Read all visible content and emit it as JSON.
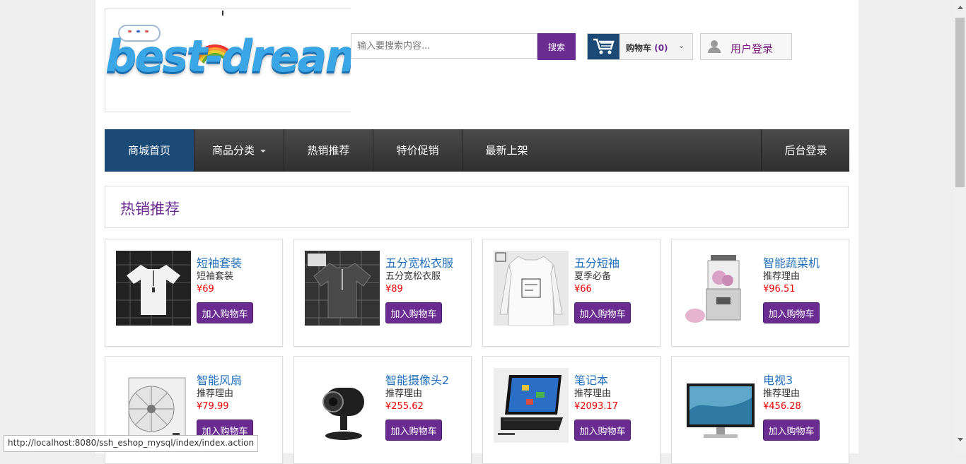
{
  "logo": {
    "text": "best-dream"
  },
  "search": {
    "placeholder": "输入要搜索内容...",
    "button": "搜索"
  },
  "cart": {
    "label": "购物车",
    "count_open": "(",
    "count": "0",
    "count_close": ")"
  },
  "login": {
    "label": "用户登录"
  },
  "nav": {
    "home": "商城首页",
    "categories": "商品分类",
    "hot": "热销推荐",
    "sale": "特价促销",
    "new": "最新上架",
    "admin": "后台登录"
  },
  "section": {
    "title": "热销推荐"
  },
  "add_to_cart": "加入购物车",
  "products": [
    {
      "name": "短袖套装",
      "desc": "短袖套装",
      "price": "¥69"
    },
    {
      "name": "五分宽松衣服",
      "desc": "五分宽松衣服",
      "price": "¥89"
    },
    {
      "name": "五分短袖",
      "desc": "夏季必备",
      "price": "¥66"
    },
    {
      "name": "智能蔬菜机",
      "desc": "推荐理由",
      "price": "¥96.51"
    },
    {
      "name": "智能风扇",
      "desc": "推荐理由",
      "price": "¥79.99"
    },
    {
      "name": "智能摄像头2",
      "desc": "推荐理由",
      "price": "¥255.62"
    },
    {
      "name": "笔记本",
      "desc": "推荐理由",
      "price": "¥2093.17"
    },
    {
      "name": "电视3",
      "desc": "推荐理由",
      "price": "¥456.28"
    }
  ],
  "status_url": "http://localhost:8080/ssh_eshop_mysql/index/index.action",
  "colors": {
    "accent": "#6a2c91",
    "nav_active": "#1c4a77",
    "price": "#e00000",
    "link": "#1f6fbd"
  }
}
